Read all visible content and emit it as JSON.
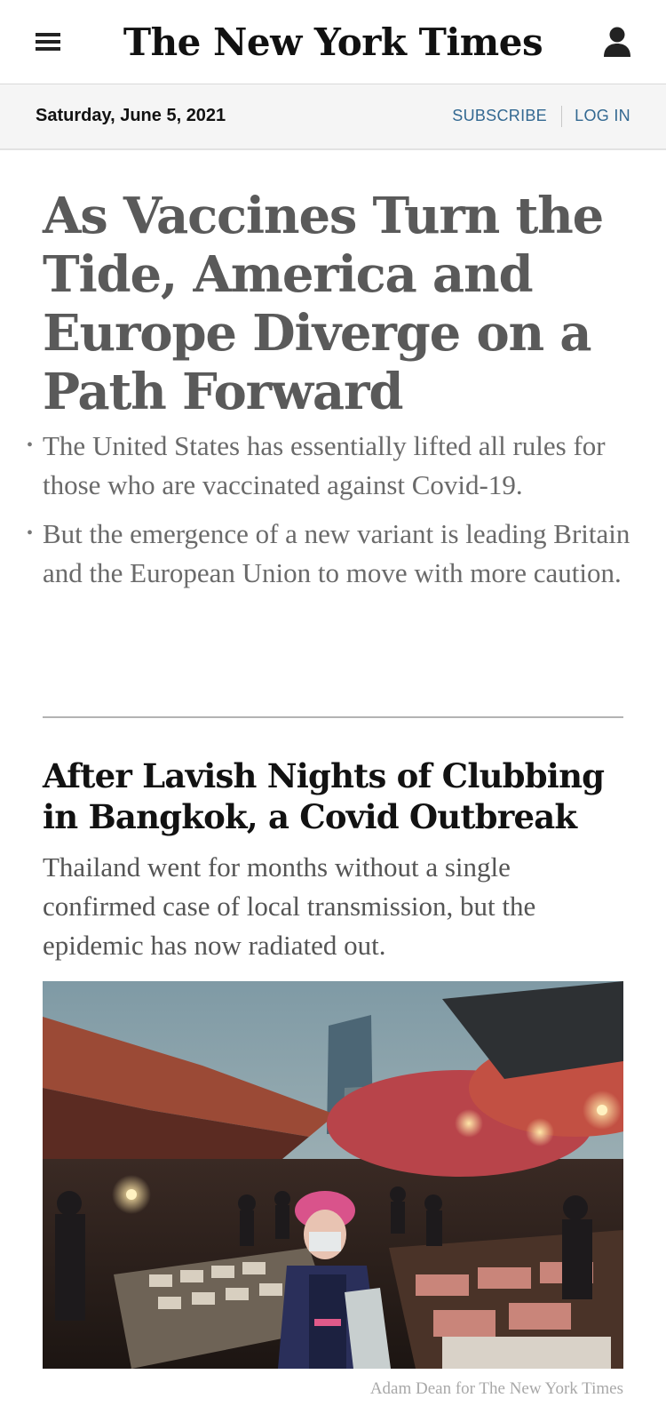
{
  "masthead": {
    "logo_text": "The New York Times",
    "menu_icon": "hamburger-menu-icon",
    "account_icon": "user-account-icon"
  },
  "datebar": {
    "date": "Saturday, June 5, 2021",
    "subscribe_label": "SUBSCRIBE",
    "login_label": "LOG IN",
    "link_color": "#326891"
  },
  "lead_story": {
    "headline": "As Vaccines Turn the Tide, America and Europe Diverge on a Path Forward",
    "bullets": [
      "The United States has essentially lifted all rules for those who are vaccinated against Covid-19.",
      "But the emergence of a new variant is leading Britain and the European Union to move with more caution."
    ]
  },
  "second_story": {
    "headline": "After Lavish Nights of Clubbing in Bangkok, a Covid Outbreak",
    "summary": "Thailand went for months without a single confirmed case of local transmission, but the epidemic has now radiated out.",
    "photo_credit": "Adam Dean for The New York Times"
  }
}
